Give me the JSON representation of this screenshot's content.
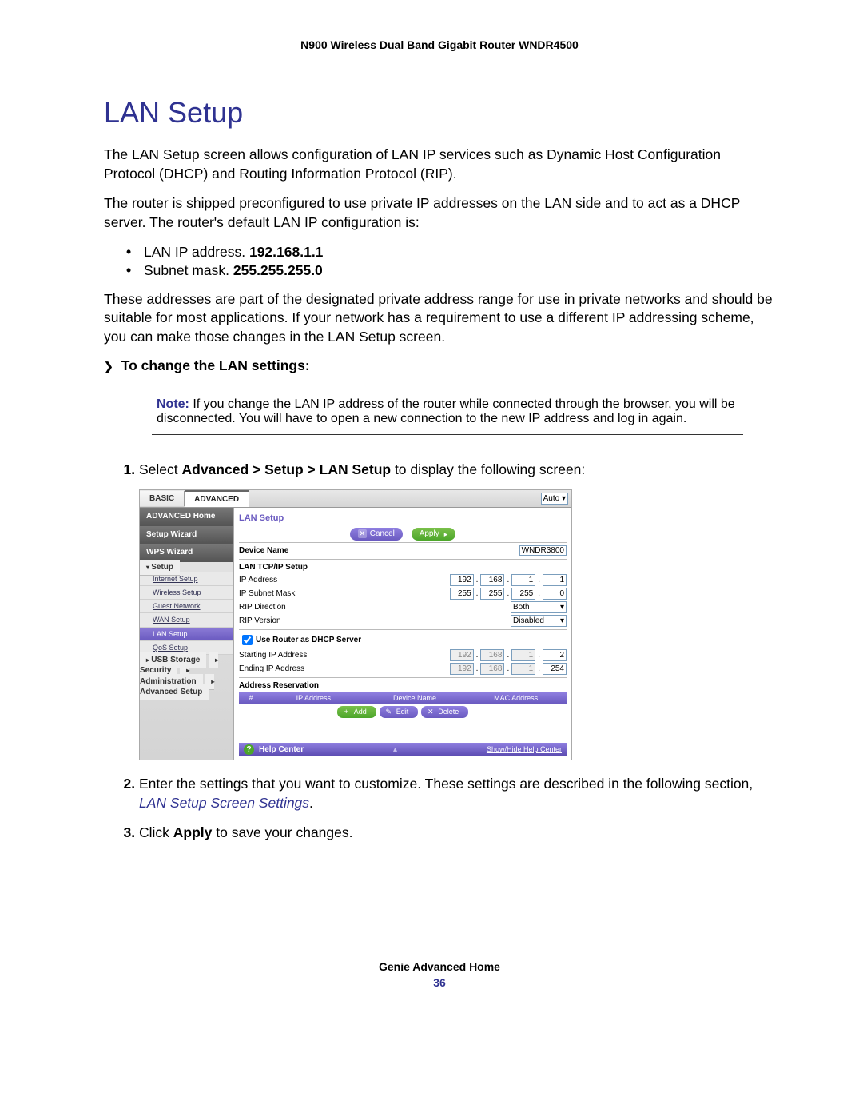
{
  "doc_header": "N900 Wireless Dual Band Gigabit Router WNDR4500",
  "section_title": "LAN Setup",
  "para1": "The LAN Setup screen allows configuration of LAN IP services such as Dynamic Host Configuration Protocol (DHCP) and Routing Information Protocol (RIP).",
  "para2": "The router is shipped preconfigured to use private IP addresses on the LAN side and to act as a DHCP server. The router's default LAN IP configuration is:",
  "bullets": {
    "b1_pre": "LAN IP address. ",
    "b1_val": "192.168.1.1",
    "b2_pre": "Subnet mask. ",
    "b2_val": "255.255.255.0"
  },
  "para3": "These addresses are part of the designated private address range for use in private networks and should be suitable for most applications. If your network has a requirement to use a different IP addressing scheme, you can make those changes in the LAN Setup screen.",
  "proc_heading": "To change the LAN settings:",
  "note": {
    "label": "Note:",
    "text": "  If you change the LAN IP address of the router while connected through the browser, you will be disconnected. You will have to open a new connection to the new IP address and log in again."
  },
  "steps": {
    "s1_pre": "Select ",
    "s1_path": "Advanced > Setup > LAN Setup",
    "s1_post": " to display the following screen:",
    "s2_pre": "Enter the settings that you want to customize. These settings are described in the following section, ",
    "s2_link": "LAN Setup Screen Settings",
    "s2_post": ".",
    "s3_pre": "Click ",
    "s3_bold": "Apply",
    "s3_post": " to save your changes."
  },
  "ui": {
    "tabs": {
      "basic": "BASIC",
      "advanced": "ADVANCED"
    },
    "auto": "Auto",
    "sidebar": {
      "adv_home": "ADVANCED Home",
      "setup_wizard": "Setup Wizard",
      "wps_wizard": "WPS Wizard",
      "setup": "Setup",
      "internet_setup": "Internet Setup",
      "wireless_setup": "Wireless Setup",
      "guest_network": "Guest Network",
      "wan_setup": "WAN Setup",
      "lan_setup": "LAN Setup",
      "qos_setup": "QoS Setup",
      "usb_storage": "USB Storage",
      "security": "Security",
      "administration": "Administration",
      "advanced_setup": "Advanced Setup"
    },
    "panel": {
      "title": "LAN Setup",
      "cancel": "Cancel",
      "apply": "Apply",
      "device_name_label": "Device Name",
      "device_name_value": "WNDR3800",
      "tcpip": "LAN TCP/IP Setup",
      "ip_address": "IP Address",
      "ip_values": [
        "192",
        "168",
        "1",
        "1"
      ],
      "subnet": "IP Subnet Mask",
      "subnet_values": [
        "255",
        "255",
        "255",
        "0"
      ],
      "rip_dir": "RIP Direction",
      "rip_dir_val": "Both",
      "rip_ver": "RIP Version",
      "rip_ver_val": "Disabled",
      "dhcp_checkbox": "Use Router as DHCP Server",
      "start_ip": "Starting IP Address",
      "start_ip_values": [
        "192",
        "168",
        "1",
        "2"
      ],
      "end_ip": "Ending IP Address",
      "end_ip_values": [
        "192",
        "168",
        "1",
        "254"
      ],
      "addr_res": "Address Reservation",
      "th": [
        "#",
        "IP Address",
        "Device Name",
        "MAC Address"
      ],
      "add": "Add",
      "edit": "Edit",
      "delete": "Delete",
      "help_center": "Help Center",
      "help_link": "Show/Hide Help Center"
    }
  },
  "footer": {
    "text": "Genie Advanced Home",
    "page": "36"
  }
}
